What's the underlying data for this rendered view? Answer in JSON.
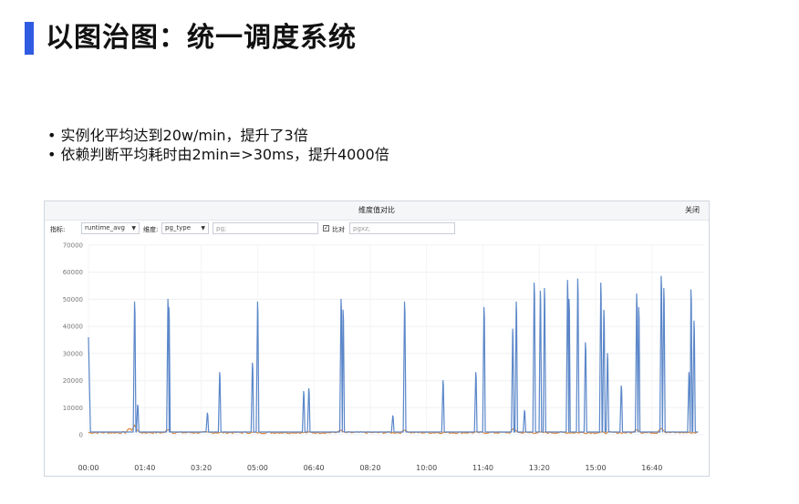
{
  "slide": {
    "title": "以图治图：统一调度系统",
    "bullets": [
      "实例化平均达到20w/min，提升了3倍",
      "依赖判断平均耗时由2min=>30ms，提升4000倍"
    ],
    "accent_color": "#2f5be3"
  },
  "panel": {
    "title": "维度值对比",
    "close_label": "关闭",
    "metric_label": "指标:",
    "metric_value": "runtime_avg",
    "dimension_label": "维度:",
    "dimension_value": "pg_type",
    "filter_value": "pg;",
    "compare_checked": true,
    "compare_label": "比对",
    "compare_value": "pgxz;"
  },
  "chart_data": {
    "type": "line",
    "ylim": [
      0,
      70000
    ],
    "yticks": [
      0,
      10000,
      20000,
      30000,
      40000,
      50000,
      60000,
      70000
    ],
    "xtick_labels": [
      "00:00",
      "01:40",
      "03:20",
      "05:00",
      "06:40",
      "08:20",
      "10:00",
      "11:40",
      "13:20",
      "15:00",
      "16:40"
    ],
    "x_range_minutes": [
      0,
      1080
    ],
    "baseline": 1000,
    "colors": {
      "pg": "#5b87c9",
      "pgxz": "#e08a3c"
    },
    "series": [
      {
        "name": "pg",
        "peaks": [
          {
            "x": 1,
            "y": 36000
          },
          {
            "x": 90,
            "y": 49000
          },
          {
            "x": 96,
            "y": 11000
          },
          {
            "x": 155,
            "y": 50000
          },
          {
            "x": 157,
            "y": 47000
          },
          {
            "x": 232,
            "y": 8000
          },
          {
            "x": 256,
            "y": 23000
          },
          {
            "x": 320,
            "y": 26500
          },
          {
            "x": 330,
            "y": 49000
          },
          {
            "x": 420,
            "y": 16000
          },
          {
            "x": 430,
            "y": 17000
          },
          {
            "x": 493,
            "y": 50000
          },
          {
            "x": 497,
            "y": 46000
          },
          {
            "x": 594,
            "y": 7000
          },
          {
            "x": 617,
            "y": 49000
          },
          {
            "x": 692,
            "y": 20000
          },
          {
            "x": 756,
            "y": 23000
          },
          {
            "x": 772,
            "y": 47000
          },
          {
            "x": 828,
            "y": 39000
          },
          {
            "x": 835,
            "y": 49000
          },
          {
            "x": 851,
            "y": 9000
          },
          {
            "x": 870,
            "y": 56000
          },
          {
            "x": 882,
            "y": 53000
          },
          {
            "x": 890,
            "y": 54000
          },
          {
            "x": 935,
            "y": 57000
          },
          {
            "x": 938,
            "y": 50000
          },
          {
            "x": 955,
            "y": 57500
          },
          {
            "x": 970,
            "y": 34000
          },
          {
            "x": 1000,
            "y": 56000
          },
          {
            "x": 1006,
            "y": 46000
          },
          {
            "x": 1013,
            "y": 30000
          },
          {
            "x": 1040,
            "y": 18000
          },
          {
            "x": 1070,
            "y": 52000
          },
          {
            "x": 1074,
            "y": 47000
          },
          {
            "x": 1118,
            "y": 58500
          },
          {
            "x": 1123,
            "y": 54000
          },
          {
            "x": 1172,
            "y": 23000
          },
          {
            "x": 1176,
            "y": 53500
          },
          {
            "x": 1182,
            "y": 42000
          }
        ]
      },
      {
        "name": "pgxz",
        "level": 800,
        "bumps": [
          {
            "x": 80,
            "y": 2500
          },
          {
            "x": 90,
            "y": 3500
          },
          {
            "x": 155,
            "y": 2000
          },
          {
            "x": 492,
            "y": 1800
          },
          {
            "x": 617,
            "y": 1800
          },
          {
            "x": 830,
            "y": 2500
          },
          {
            "x": 1070,
            "y": 2000
          },
          {
            "x": 1118,
            "y": 2500
          }
        ]
      }
    ]
  }
}
